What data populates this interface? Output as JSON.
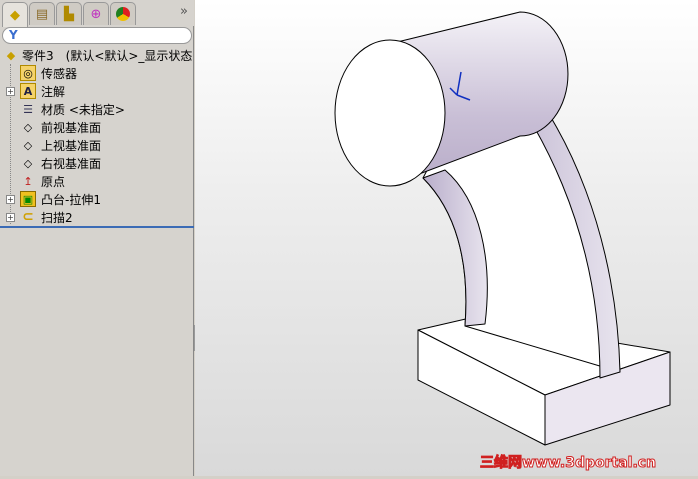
{
  "feature_manager": {
    "tabs": [
      {
        "name": "featuremanager-tab",
        "icon": "part-icon"
      },
      {
        "name": "propertymanager-tab",
        "icon": "property-icon"
      },
      {
        "name": "configurationmanager-tab",
        "icon": "config-icon"
      },
      {
        "name": "dimxpert-tab",
        "icon": "crosshair-icon"
      },
      {
        "name": "display-manager-tab",
        "icon": "appearance-icon"
      }
    ],
    "more": "»",
    "filter_icon": "Y",
    "root": {
      "label": "零件3　(默认<默认>_显示状态"
    },
    "items": [
      {
        "label": "传感器",
        "icon": "sensor-folder-icon",
        "expand": false
      },
      {
        "label": "注解",
        "icon": "annotation-folder-icon",
        "expand": true
      },
      {
        "label": "材质 <未指定>",
        "icon": "material-icon",
        "expand": false
      },
      {
        "label": "前视基准面",
        "icon": "plane-icon",
        "expand": false
      },
      {
        "label": "上视基准面",
        "icon": "plane-icon",
        "expand": false
      },
      {
        "label": "右视基准面",
        "icon": "plane-icon",
        "expand": false
      },
      {
        "label": "原点",
        "icon": "origin-icon",
        "expand": false
      },
      {
        "label": "凸台-拉伸1",
        "icon": "boss-extrude-icon",
        "expand": true
      },
      {
        "label": "扫描2",
        "icon": "sweep-icon",
        "expand": true
      }
    ]
  },
  "watermark": "三维网www.3dportal.cn",
  "colors": {
    "selection_bar": "#3b6bb5",
    "model_shade": "#c9bfd6"
  }
}
